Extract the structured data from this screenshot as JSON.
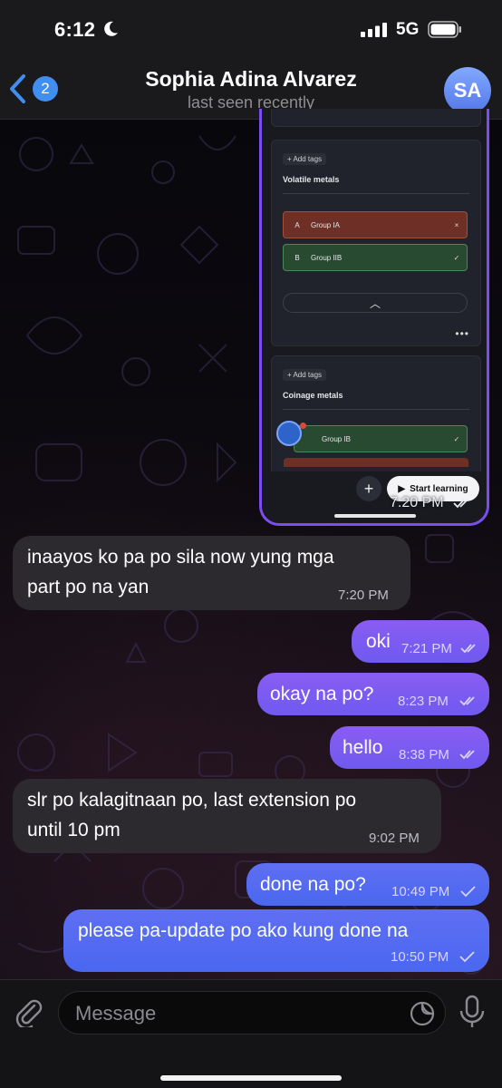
{
  "status_bar": {
    "time": "6:12",
    "network": "5G",
    "icons": [
      "moon-icon",
      "signal-icon",
      "battery-icon"
    ]
  },
  "header": {
    "back_count": "2",
    "contact_name": "Sophia Adina Alvarez",
    "status": "last seen recently",
    "avatar_initials": "SA"
  },
  "screenshot_message": {
    "time": "7:20 PM",
    "card1": {
      "add_tags": "+ Add tags",
      "title": "Volatile metals",
      "options": [
        {
          "letter": "A",
          "label": "Group IA",
          "mark": "×"
        },
        {
          "letter": "B",
          "label": "Group IIB",
          "mark": "✓"
        }
      ]
    },
    "card2": {
      "add_tags": "+ Add tags",
      "title": "Coinage metals",
      "options": [
        {
          "label": "Group IB",
          "mark": "✓"
        }
      ]
    },
    "start_label": "Start learning"
  },
  "messages": [
    {
      "direction": "in",
      "text1": "inaayos ko pa po sila now yung mga",
      "text2": "part po na yan",
      "time": "7:20 PM"
    },
    {
      "direction": "out",
      "text": "oki",
      "time": "7:21 PM",
      "status": "read"
    },
    {
      "direction": "out",
      "text": "okay na po?",
      "time": "8:23 PM",
      "status": "read"
    },
    {
      "direction": "out",
      "text": "hello",
      "time": "8:38 PM",
      "status": "read"
    },
    {
      "direction": "in",
      "text1": "slr po kalagitnaan po, last extension po",
      "text2": "until 10 pm",
      "time": "9:02 PM"
    },
    {
      "direction": "out",
      "text": "done na po?",
      "time": "10:49 PM",
      "status": "sent"
    },
    {
      "direction": "out",
      "text": "please pa-update po ako kung done na",
      "time": "10:50 PM",
      "status": "sent"
    }
  ],
  "composer": {
    "placeholder": "Message"
  },
  "colors": {
    "accent": "#3f8ef0",
    "outgoing": "#7a5cf2",
    "incoming": "#2c2a2f"
  }
}
